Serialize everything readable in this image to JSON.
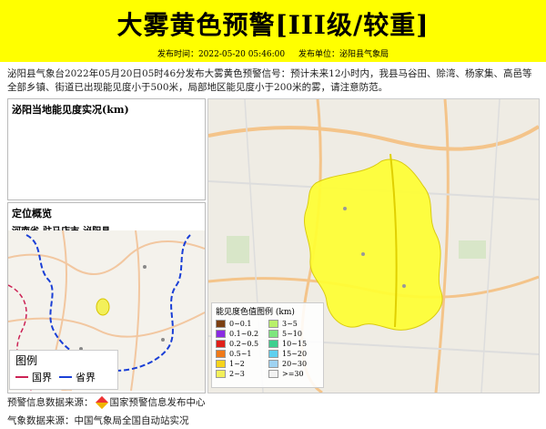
{
  "header": {
    "title": "大雾黄色预警[III级/较重]",
    "time_label": "发布时间：2022-05-20 05:46:00",
    "unit_label": "发布单位：泌阳县气象局",
    "bg_color": "#ffff00"
  },
  "content": {
    "text": "泌阳县气象台2022年05月20日05时46分发布大雾黄色预警信号：预计未来12小时内，我县马谷田、赊湾、杨家集、高邑等全部乡镇、街道已出现能见度小于500米，局部地区能见度小于200米的雾，请注意防范。"
  },
  "vis_panel": {
    "title": "泌阳当地能见度实况(km)"
  },
  "loc_panel": {
    "title": "定位概览",
    "subtitle": "河南省-驻马店市-泌阳县",
    "legend_title": "图例",
    "legend_border": "国界",
    "legend_province": "省界"
  },
  "map_legend": {
    "title": "能见度色值图例 (km)",
    "items": [
      {
        "label": "0~0.1",
        "color": "#7b3f12"
      },
      {
        "label": "3~5",
        "color": "#b8f06a"
      },
      {
        "label": "0.1~0.2",
        "color": "#8a2be2"
      },
      {
        "label": "5~10",
        "color": "#7ee67e"
      },
      {
        "label": "0.2~0.5",
        "color": "#e0201a"
      },
      {
        "label": "10~15",
        "color": "#3ecf8e"
      },
      {
        "label": "0.5~1",
        "color": "#f07a1a"
      },
      {
        "label": "15~20",
        "color": "#5fd0ee"
      },
      {
        "label": "1~2",
        "color": "#f7d31b"
      },
      {
        "label": "20~30",
        "color": "#9fd3f2"
      },
      {
        "label": "2~3",
        "color": "#f3f05a"
      },
      {
        "label": ">=30",
        "color": "#f2f2f2"
      }
    ]
  },
  "footer": {
    "warning_source_label": "预警信息数据来源：",
    "warning_source": "国家预警信息发布中心",
    "weather_source": "气象数据来源：中国气象局全国自动站实况"
  }
}
